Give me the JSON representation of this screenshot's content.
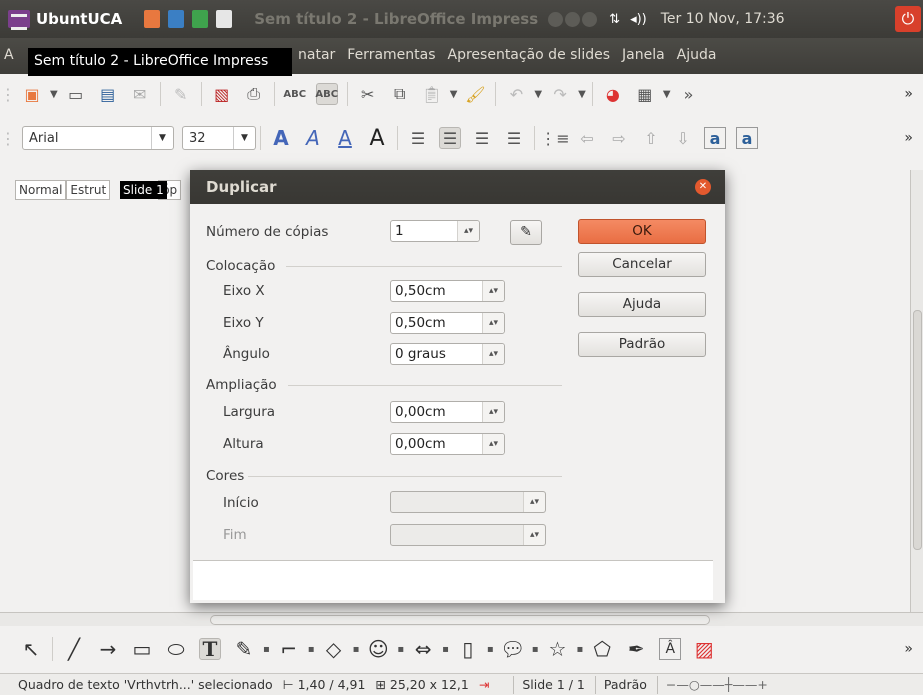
{
  "top_panel": {
    "app_name": "UbuntUCA",
    "window_title": "Sem título 2 - LibreOffice Impress",
    "clock": "Ter 10 Nov, 17:36",
    "network_icon": "⇅",
    "volume_icon": "◂))"
  },
  "menubar": {
    "lead": "A",
    "items": [
      "natar",
      "Ferramentas",
      "Apresentação de slides",
      "Janela",
      "Ajuda"
    ]
  },
  "title_tooltip": "Sem título 2 - LibreOffice Impress",
  "formatting": {
    "font_name": "Arial",
    "font_size": "32"
  },
  "view_tabs": [
    "Normal",
    "Estrut",
    "óp"
  ],
  "slide_tooltip": "Slide 1",
  "dialog": {
    "title": "Duplicar",
    "copies_label": "Número de cópias",
    "copies_value": "1",
    "placement_group": "Colocação",
    "x_axis_label": "Eixo X",
    "x_axis_value": "0,50cm",
    "y_axis_label": "Eixo Y",
    "y_axis_value": "0,50cm",
    "angle_label": "Ângulo",
    "angle_value": "0 graus",
    "enlargement_group": "Ampliação",
    "width_label": "Largura",
    "width_value": "0,00cm",
    "height_label": "Altura",
    "height_value": "0,00cm",
    "colors_group": "Cores",
    "start_label": "Início",
    "end_label": "Fim",
    "ok_label": "OK",
    "cancel_label": "Cancelar",
    "help_label": "Ajuda",
    "default_label": "Padrão"
  },
  "statusbar": {
    "selection": "Quadro de texto 'Vrthvtrh...' selecionado",
    "position": "1,40 / 4,91",
    "size": "25,20 x 12,1",
    "slide": "Slide 1 / 1",
    "layout": "Padrão"
  },
  "colors": {
    "panel_bg": "#3c3b37",
    "accent": "#e96e43",
    "dialog_bg": "#f2f1f0"
  }
}
